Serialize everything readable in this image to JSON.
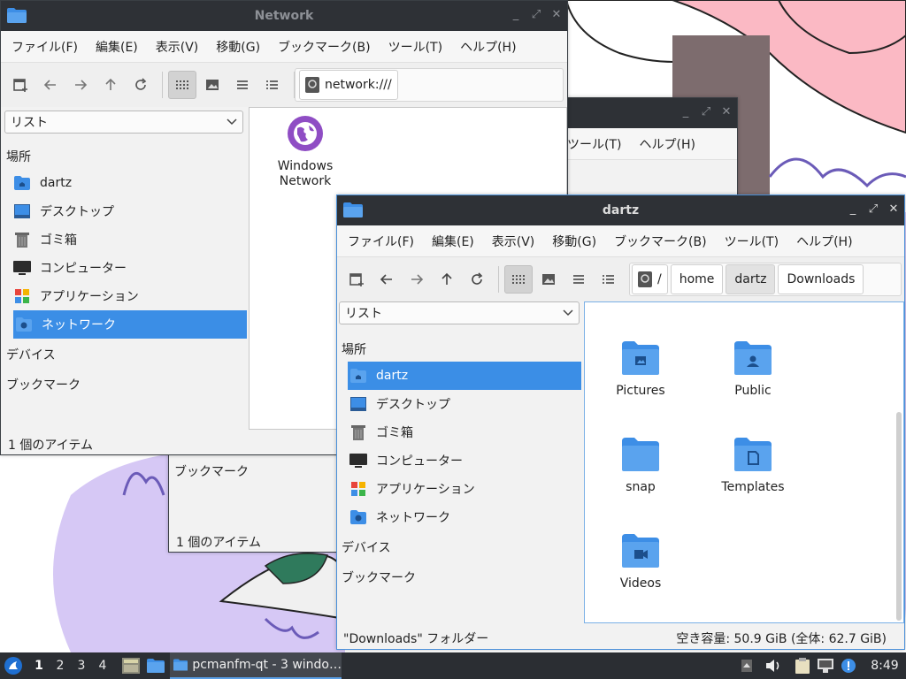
{
  "colors": {
    "accent": "#3b8ee6",
    "titlebar": "#2e3136",
    "folder": "#3d8ee6"
  },
  "network_window": {
    "title": "Network",
    "menu": [
      "ファイル(F)",
      "編集(E)",
      "表示(V)",
      "移動(G)",
      "ブックマーク(B)",
      "ツール(T)",
      "ヘルプ(H)"
    ],
    "path": "network:///",
    "view_mode": "リスト",
    "places_header": "場所",
    "places": [
      "dartz",
      "デスクトップ",
      "ゴミ箱",
      "コンピューター",
      "アプリケーション",
      "ネットワーク"
    ],
    "devices_header": "デバイス",
    "bookmarks_header": "ブックマーク",
    "items": [
      {
        "label_line1": "Windows",
        "label_line2": "Network",
        "icon": "network-globe-icon"
      }
    ],
    "status": "1 個のアイテム"
  },
  "background_window": {
    "menu_partial": [
      "ツール(T)",
      "ヘルプ(H)"
    ],
    "bookmarks_header": "ブックマーク",
    "status": "1 個のアイテム"
  },
  "dartz_window": {
    "title": "dartz",
    "menu": [
      "ファイル(F)",
      "編集(E)",
      "表示(V)",
      "移動(G)",
      "ブックマーク(B)",
      "ツール(T)",
      "ヘルプ(H)"
    ],
    "breadcrumbs": [
      "/",
      "home",
      "dartz",
      "Downloads"
    ],
    "view_mode": "リスト",
    "places_header": "場所",
    "places": [
      "dartz",
      "デスクトップ",
      "ゴミ箱",
      "コンピューター",
      "アプリケーション",
      "ネットワーク"
    ],
    "devices_header": "デバイス",
    "bookmarks_header": "ブックマーク",
    "items": [
      {
        "label": "Pictures",
        "icon": "pictures-folder-icon"
      },
      {
        "label": "Public",
        "icon": "public-folder-icon"
      },
      {
        "label": "snap",
        "icon": "folder-icon"
      },
      {
        "label": "Templates",
        "icon": "templates-folder-icon"
      },
      {
        "label": "Videos",
        "icon": "videos-folder-icon"
      }
    ],
    "status_left": "\"Downloads\" フォルダー",
    "status_right": "空き容量: 50.9 GiB (全体: 62.7 GiB)"
  },
  "taskbar": {
    "workspaces": [
      "1",
      "2",
      "3",
      "4"
    ],
    "task_label": "pcmanfm-qt - 3 windo…",
    "clock": "8:49"
  }
}
